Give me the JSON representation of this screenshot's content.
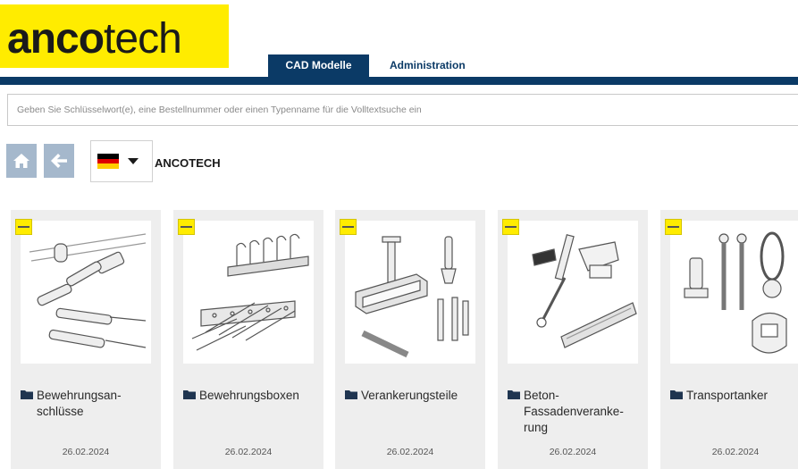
{
  "header": {
    "logo_bold": "anco",
    "logo_light": "tech",
    "tabs": [
      {
        "label": "CAD Modelle",
        "active": true
      },
      {
        "label": "Administration",
        "active": false
      }
    ],
    "colors": {
      "brand_yellow": "#ffec00",
      "nav_blue": "#0b3a66",
      "button_gray_blue": "#a5b8cc"
    }
  },
  "search": {
    "placeholder": "Geben Sie Schlüsselwort(e), eine Bestellnummer oder einen Typenname für die Volltextsuche ein",
    "value": ""
  },
  "toolbar": {
    "home_icon": "home-icon",
    "back_icon": "arrow-left-icon",
    "language": {
      "flag": "germany-flag",
      "dropdown_icon": "caret-down-icon"
    },
    "breadcrumb": "ANCOTECH"
  },
  "cards": [
    {
      "label": "Bewehrungsan-\nschlüsse",
      "date": "26.02.2024",
      "icon": "folder-icon"
    },
    {
      "label": "Bewehrungsboxen",
      "date": "26.02.2024",
      "icon": "folder-icon"
    },
    {
      "label": "Verankerungsteile",
      "date": "26.02.2024",
      "icon": "folder-icon"
    },
    {
      "label": "Beton-\nFassadenveranke-\nrung",
      "date": "26.02.2024",
      "icon": "folder-icon"
    },
    {
      "label": "Transportanker",
      "date": "26.02.2024",
      "icon": "folder-icon"
    }
  ]
}
